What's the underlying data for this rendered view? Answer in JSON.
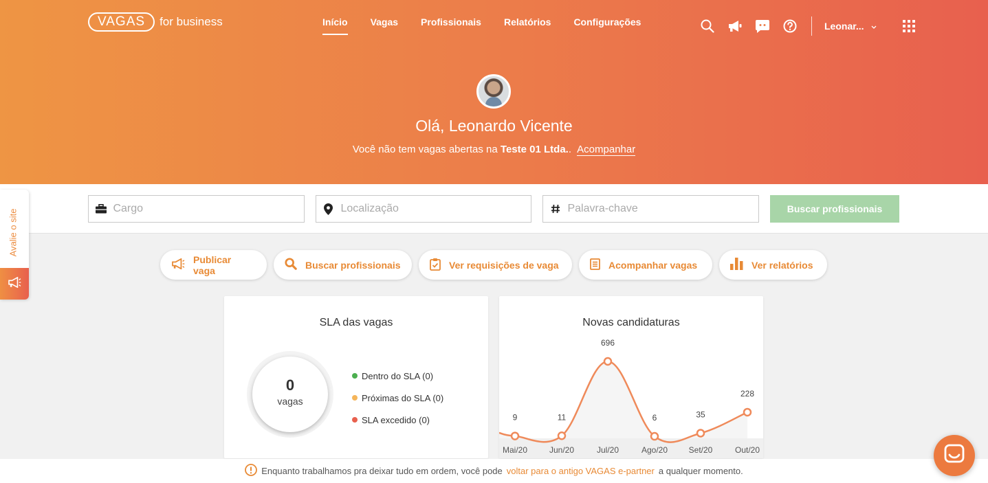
{
  "header": {
    "logo_main": "VAGAS",
    "logo_sub": "for business",
    "nav": [
      "Início",
      "Vagas",
      "Profissionais",
      "Relatórios",
      "Configurações"
    ],
    "user_name": "Leonar...",
    "icons": [
      "search-icon",
      "megaphone-icon",
      "chat-bubble-icon",
      "help-icon",
      "chevron-down-icon",
      "apps-grid-icon"
    ]
  },
  "hero": {
    "greeting": "Olá, Leonardo Vicente",
    "subline_prefix": "Você não tem vagas abertas na",
    "company": "Teste 01 Ltda.",
    "subline_suffix": ".",
    "link": "Acompanhar"
  },
  "search": {
    "cargo_placeholder": "Cargo",
    "local_placeholder": "Localização",
    "keyword_placeholder": "Palavra-chave",
    "button_label": "Buscar profissionais"
  },
  "side_tab": {
    "label": "Avalie o site"
  },
  "quick_actions": [
    "Publicar vaga",
    "Buscar profissionais",
    "Ver requisições de vaga",
    "Acompanhar vagas",
    "Ver relatórios"
  ],
  "sla_card": {
    "title": "SLA das vagas",
    "count": "0",
    "unit": "vagas",
    "legend": [
      {
        "label": "Dentro do SLA (0)",
        "color": "#4caf50"
      },
      {
        "label": "Próximas do SLA (0)",
        "color": "#f5b55a"
      },
      {
        "label": "SLA excedido (0)",
        "color": "#e8604e"
      }
    ]
  },
  "chart_data": {
    "type": "line",
    "title": "Novas candidaturas",
    "categories": [
      "Mai/20",
      "Jun/20",
      "Jul/20",
      "Ago/20",
      "Set/20",
      "Out/20"
    ],
    "values": [
      9,
      11,
      696,
      6,
      35,
      228
    ],
    "value_labels": [
      "9",
      "11",
      "696",
      "6",
      "35",
      "228"
    ],
    "color": "#ef8a5a",
    "grid": false,
    "legend": "none"
  },
  "footer": {
    "prefix": "Enquanto trabalhamos pra deixar tudo em ordem, você pode",
    "link": "voltar para o antigo VAGAS e-partner",
    "suffix": "a qualquer momento."
  },
  "colors": {
    "accent": "#e88a35",
    "hero_start": "#ee9544",
    "hero_end": "#e8604e",
    "search_button": "#a8d5a8"
  }
}
